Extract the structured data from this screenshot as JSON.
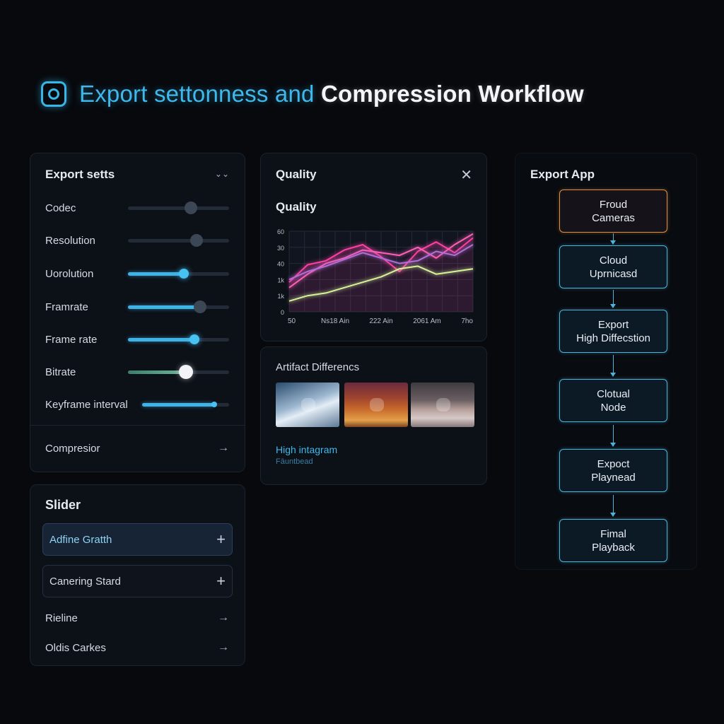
{
  "header": {
    "title_part1": "Export settonness and",
    "title_part2": "Compression Workflow"
  },
  "settings": {
    "title": "Export setts",
    "rows": [
      {
        "label": "Codec",
        "value": 0.62
      },
      {
        "label": "Resolution",
        "value": 0.68
      },
      {
        "label": "Uorolution",
        "value": 0.55
      },
      {
        "label": "Framrate",
        "value": 0.71
      },
      {
        "label": "Frame rate",
        "value": 0.66
      },
      {
        "label": "Bitrate",
        "value": 0.57
      },
      {
        "label": "Keyframe interval",
        "value": 0.83
      }
    ],
    "compression_label": "Compresior"
  },
  "slider_panel": {
    "title": "Slider",
    "buttons": [
      {
        "label": "Adfine Gratth"
      },
      {
        "label": "Canering Stard"
      }
    ],
    "links": [
      {
        "label": "Rieline"
      },
      {
        "label": "Oldis Carkes"
      }
    ]
  },
  "quality": {
    "header": "Quality",
    "subtitle": "Quality"
  },
  "chart_data": {
    "type": "line",
    "yticks": [
      "60",
      "30",
      "40",
      "1k",
      "1k",
      "0"
    ],
    "xticks": [
      "50",
      "Ns18 Ain",
      "222 Ain",
      "2061 Am",
      "7ho"
    ],
    "ylim": [
      0,
      60
    ],
    "series": [
      {
        "color": "#ff3fa4",
        "values": [
          22,
          35,
          38,
          46,
          50,
          41,
          30,
          45,
          52,
          44,
          55
        ]
      },
      {
        "color": "#ff5fb8",
        "values": [
          18,
          28,
          36,
          40,
          46,
          44,
          42,
          48,
          40,
          50,
          58
        ]
      },
      {
        "color": "#b06fd8",
        "values": [
          24,
          30,
          34,
          39,
          44,
          40,
          36,
          38,
          45,
          42,
          50
        ]
      },
      {
        "color": "#d7f39a",
        "values": [
          8,
          12,
          14,
          18,
          22,
          26,
          32,
          34,
          28,
          30,
          32
        ]
      }
    ]
  },
  "artifact": {
    "title": "Artifact Differencs",
    "link": "High intagram",
    "sub": "Fāuntbead"
  },
  "workflow": {
    "title": "Export App",
    "nodes": [
      {
        "line1": "Froud",
        "line2": "Cameras"
      },
      {
        "line1": "Cloud",
        "line2": "Uprnicasd"
      },
      {
        "line1": "Export",
        "line2": "High Diffecstion"
      },
      {
        "line1": "Clotual",
        "line2": "Node"
      },
      {
        "line1": "Expoct",
        "line2": "Playnead"
      },
      {
        "line1": "Fimal",
        "line2": "Playback"
      }
    ]
  },
  "colors": {
    "accent": "#3fb8ec",
    "background": "#07090d",
    "panel": "#0c1017",
    "flow_border": "#4cb4db",
    "flow_start_border": "#e0913a"
  }
}
